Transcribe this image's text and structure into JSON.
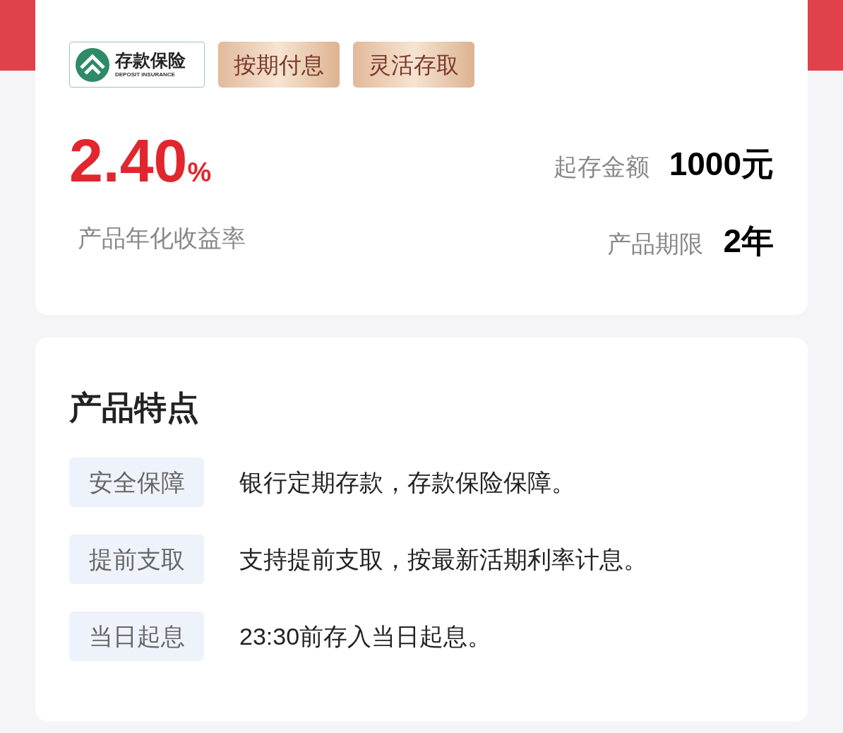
{
  "badge": {
    "title": "存款保险",
    "subtitle": "DEPOSIT INSURANCE"
  },
  "tags": [
    "按期付息",
    "灵活存取"
  ],
  "rate": {
    "value": "2.40",
    "unit": "%",
    "label": "产品年化收益率"
  },
  "terms": [
    {
      "label": "起存金额",
      "value": "1000元"
    },
    {
      "label": "产品期限",
      "value": "2年"
    }
  ],
  "features": {
    "title": "产品特点",
    "items": [
      {
        "tag": "安全保障",
        "text": "银行定期存款，存款保险保障。"
      },
      {
        "tag": "提前支取",
        "text": "支持提前支取，按最新活期利率计息。"
      },
      {
        "tag": "当日起息",
        "text": "23:30前存入当日起息。"
      }
    ]
  }
}
